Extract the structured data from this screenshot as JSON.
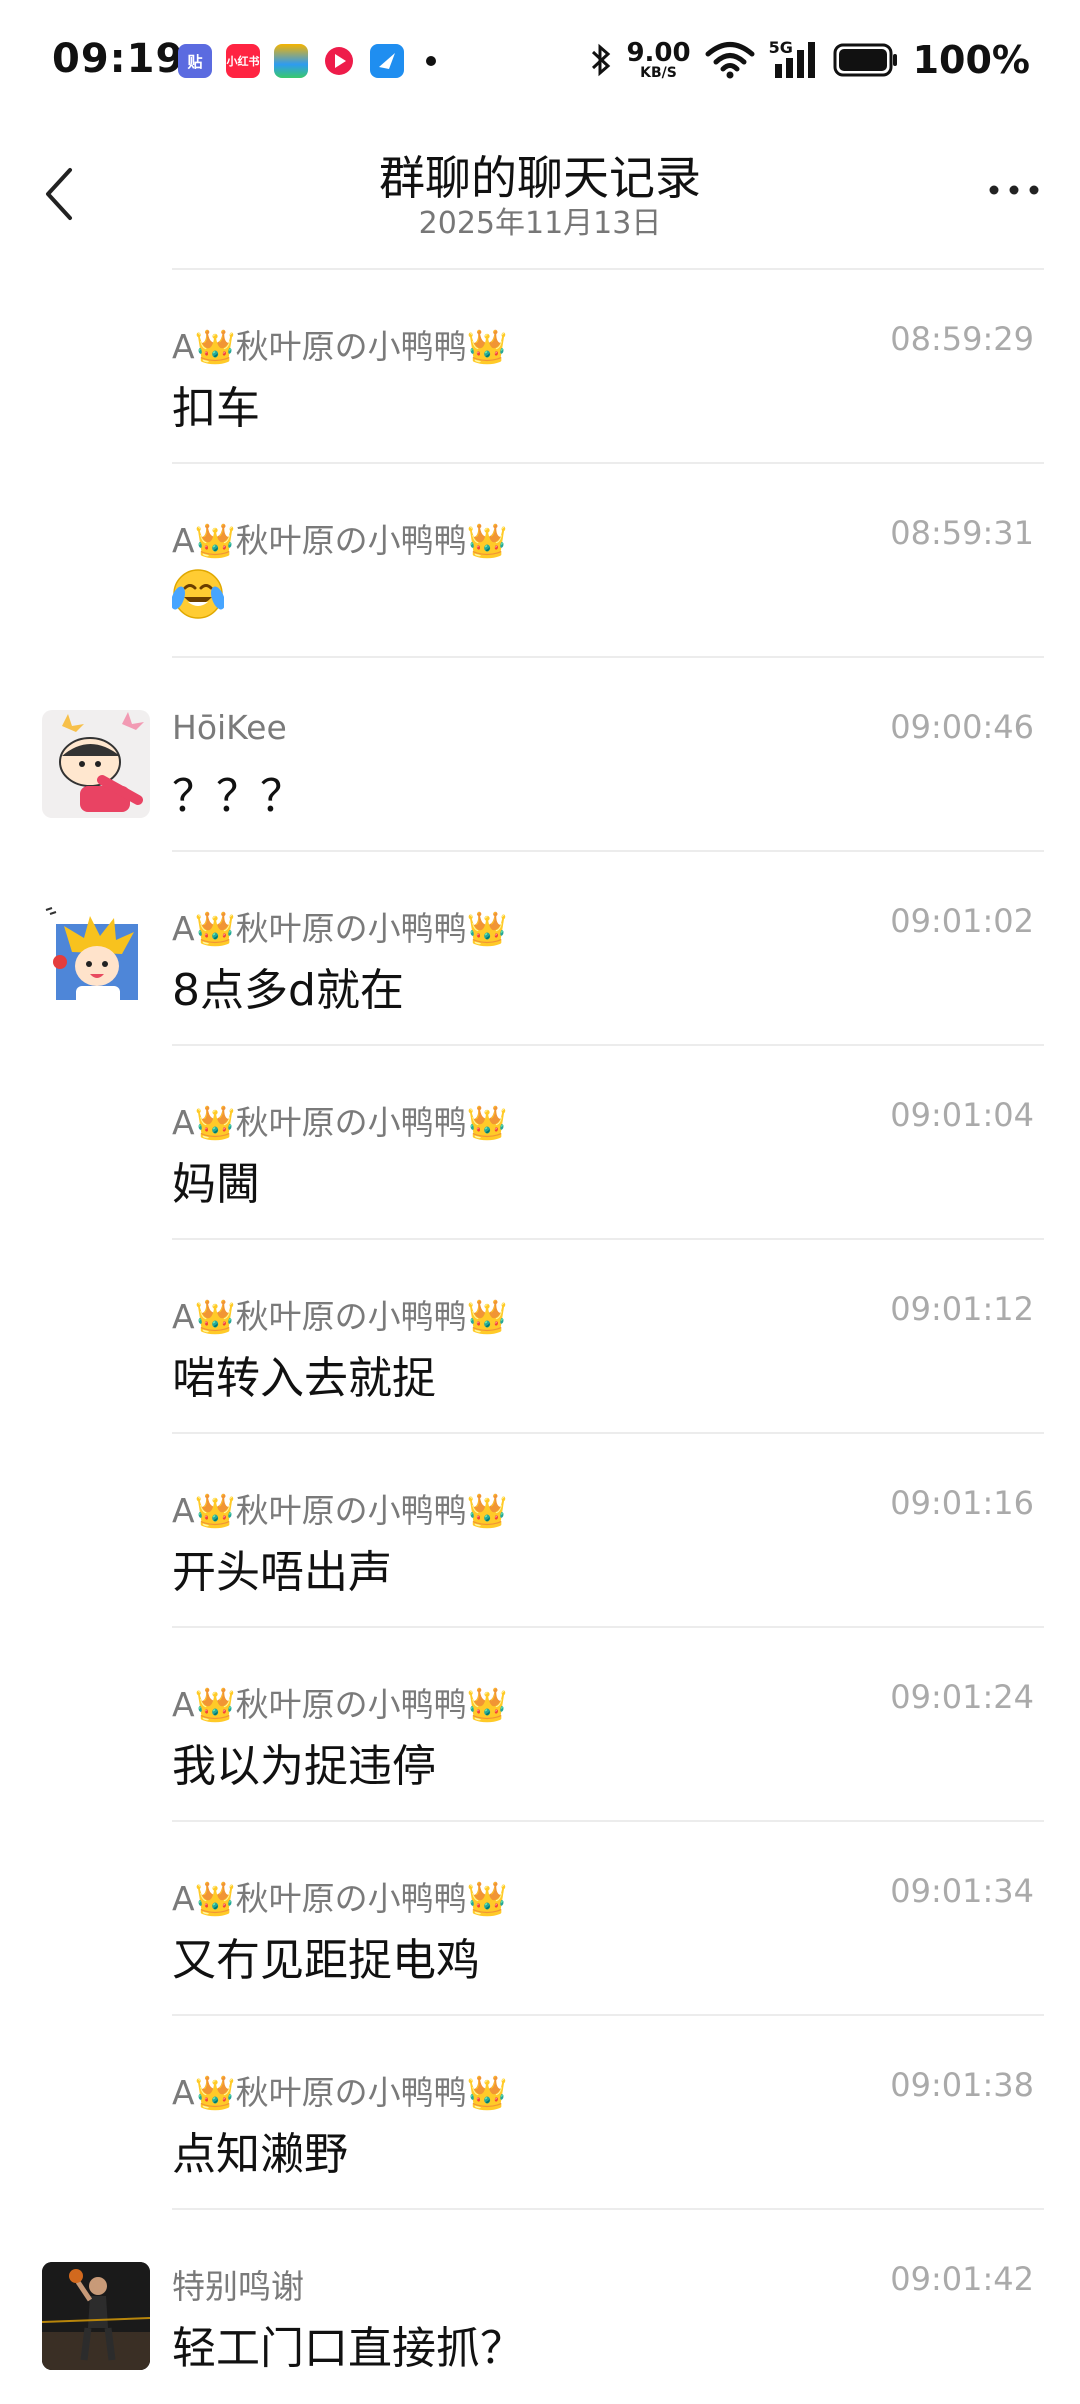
{
  "status_bar": {
    "time": "09:19",
    "net_speed_value": "9.00",
    "net_speed_unit": "KB/S",
    "network_type": "5G",
    "battery": "100%"
  },
  "header": {
    "title": "群聊的聊天记录",
    "subtitle": "2025年11月13日"
  },
  "messages": [
    {
      "sender": "A👑秋叶原の小鸭鸭👑",
      "time": "08:59:29",
      "text": "扣车",
      "avatar": ""
    },
    {
      "sender": "A👑秋叶原の小鸭鸭👑",
      "time": "08:59:31",
      "text": "",
      "emoji": "crying-laughing-emoji",
      "avatar": ""
    },
    {
      "sender": "HōiKee",
      "time": "09:00:46",
      "text": "？？？",
      "avatar": "cartoon-boy-avatar"
    },
    {
      "sender": "A👑秋叶原の小鸭鸭👑",
      "time": "09:01:02",
      "text": "8点多d就在",
      "avatar": "anime-boy-avatar"
    },
    {
      "sender": "A👑秋叶原の小鸭鸭👑",
      "time": "09:01:04",
      "text": "妈閪",
      "avatar": ""
    },
    {
      "sender": "A👑秋叶原の小鸭鸭👑",
      "time": "09:01:12",
      "text": "啱转入去就捉",
      "avatar": ""
    },
    {
      "sender": "A👑秋叶原の小鸭鸭👑",
      "time": "09:01:16",
      "text": "开头唔出声",
      "avatar": ""
    },
    {
      "sender": "A👑秋叶原の小鸭鸭👑",
      "time": "09:01:24",
      "text": "我以为捉违停",
      "avatar": ""
    },
    {
      "sender": "A👑秋叶原の小鸭鸭👑",
      "time": "09:01:34",
      "text": "又冇见距捉电鸡",
      "avatar": ""
    },
    {
      "sender": "A👑秋叶原の小鸭鸭👑",
      "time": "09:01:38",
      "text": "点知濑野",
      "avatar": ""
    },
    {
      "sender": "特别鸣谢",
      "time": "09:01:42",
      "text": "轻工门口直接抓？",
      "avatar": "basketball-player-avatar"
    }
  ]
}
